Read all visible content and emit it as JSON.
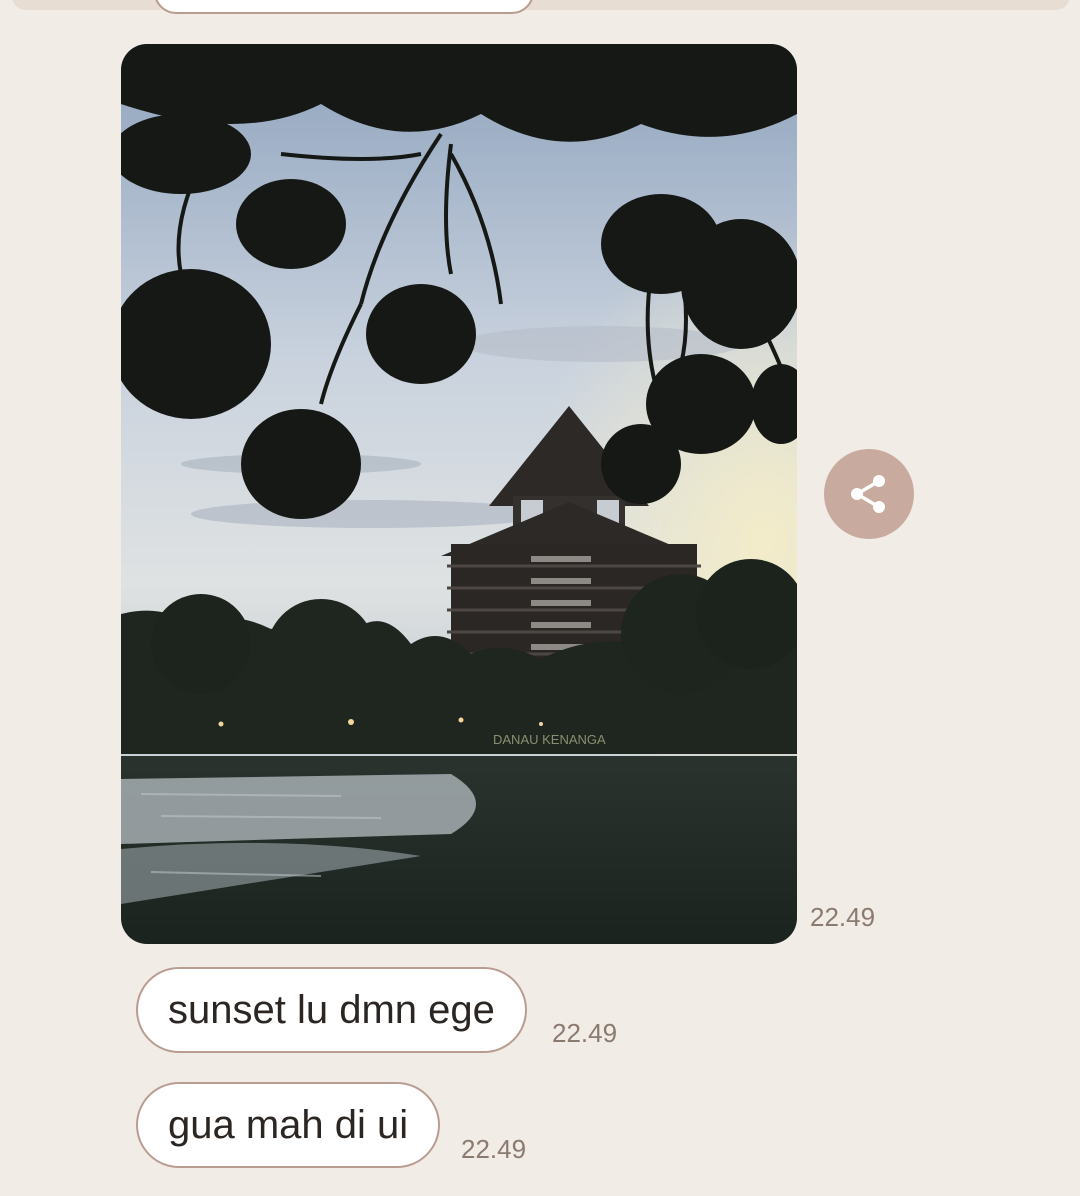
{
  "messages": [
    {
      "type": "image",
      "alt": "photo",
      "time": "22.49",
      "sign_text": "DANAU KENANGA"
    },
    {
      "type": "text",
      "text": "sunset lu dmn ege",
      "time": "22.49"
    },
    {
      "type": "text",
      "text": "gua mah di ui",
      "time": "22.49"
    }
  ],
  "icons": {
    "share": "share-icon"
  },
  "colors": {
    "background": "#f1ece6",
    "bubble_border": "#b99d92",
    "share_button": "#c9aa9f",
    "timestamp": "#8a7a70"
  }
}
